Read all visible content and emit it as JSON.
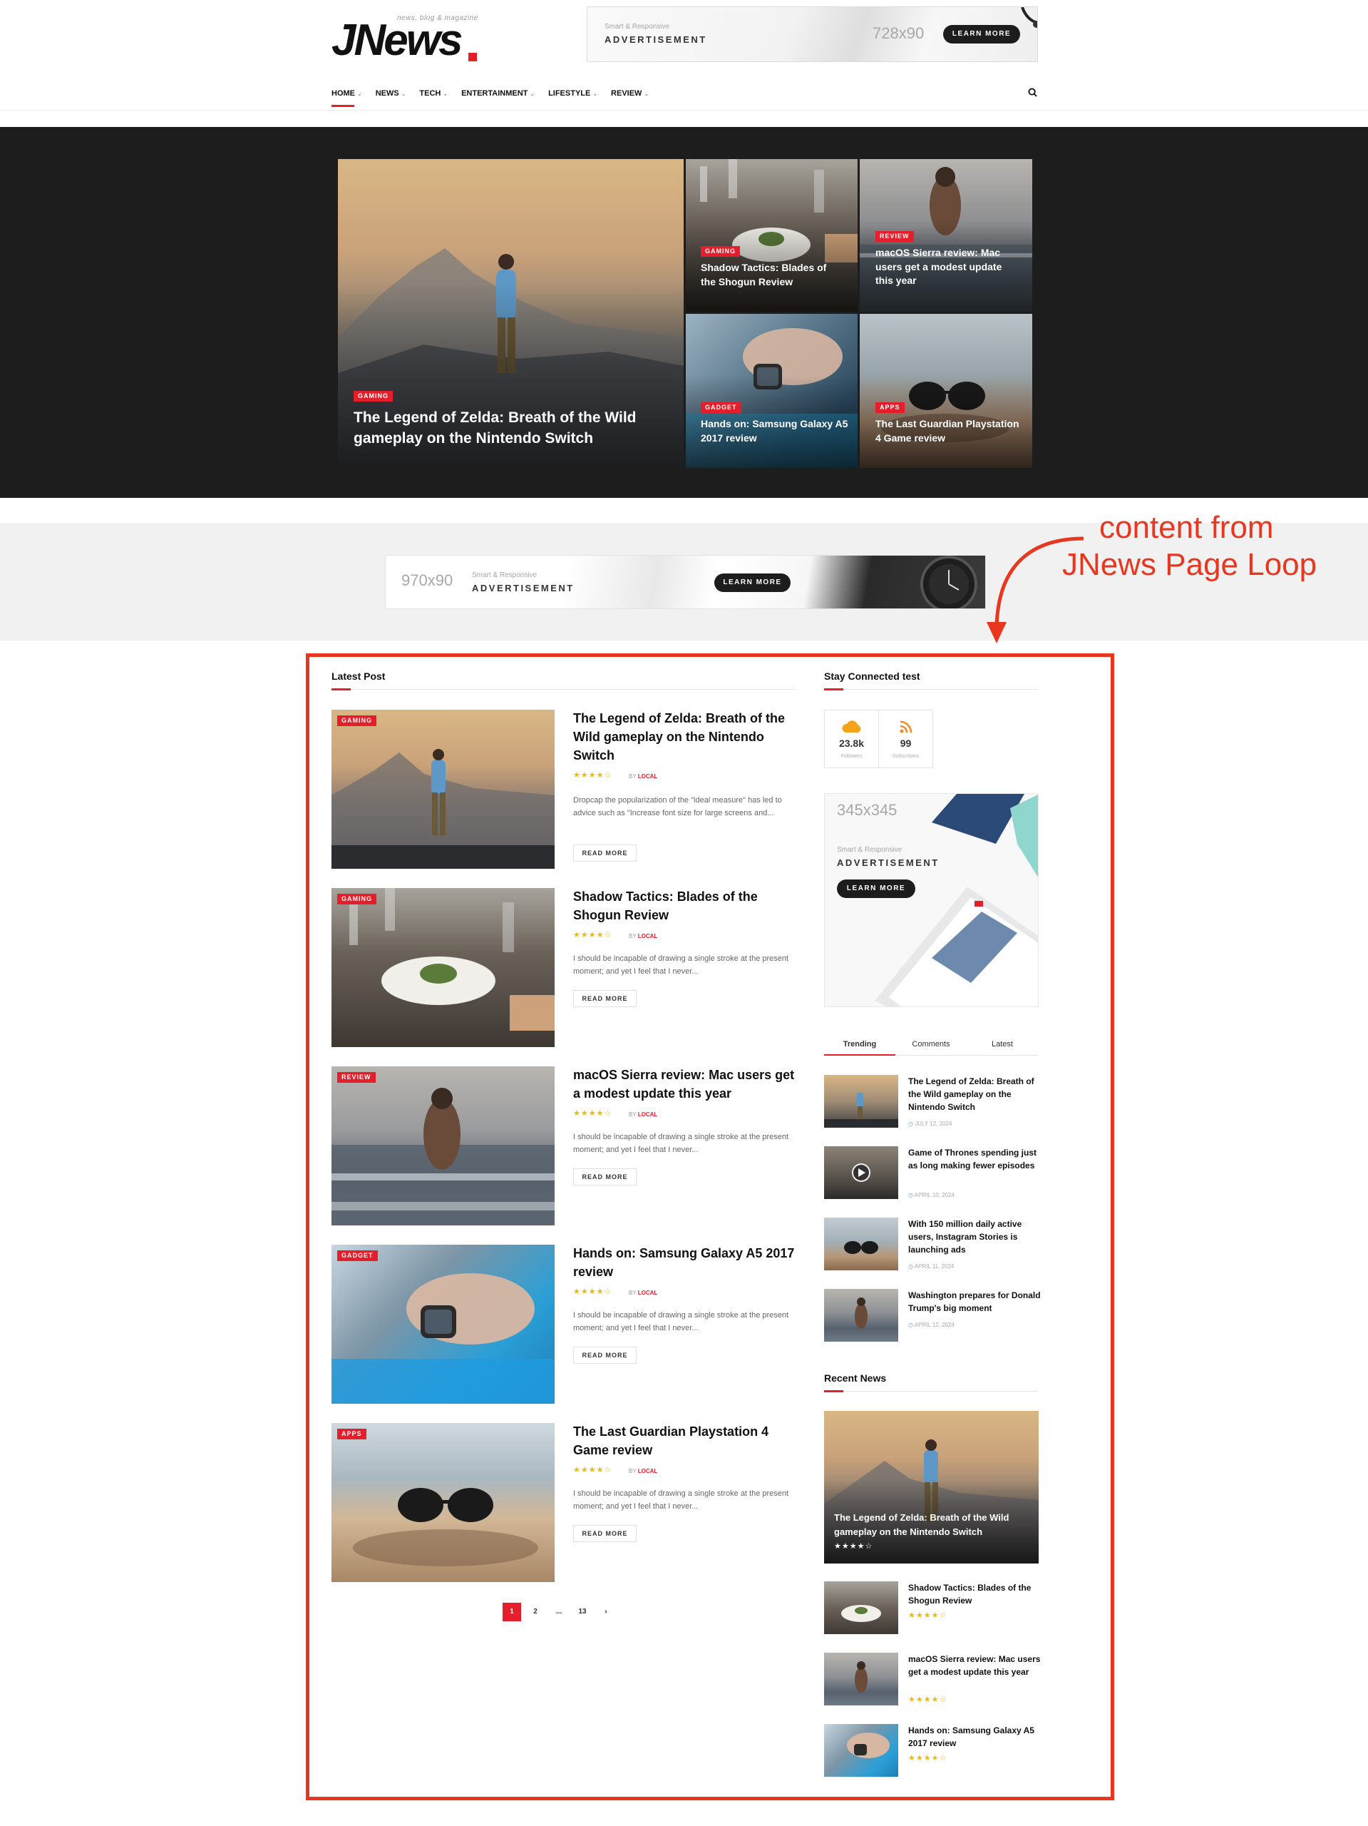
{
  "header": {
    "logo_text": "JNews",
    "logo_tagline": "news, blog & magazine",
    "ad": {
      "small": "Smart & Responsive",
      "big": "ADVERTISEMENT",
      "size": "728x90",
      "button": "LEARN MORE"
    },
    "nav": [
      {
        "label": "HOME"
      },
      {
        "label": "NEWS"
      },
      {
        "label": "TECH"
      },
      {
        "label": "ENTERTAINMENT"
      },
      {
        "label": "LIFESTYLE"
      },
      {
        "label": "REVIEW"
      }
    ]
  },
  "hero": {
    "main": {
      "category": "GAMING",
      "title": "The Legend of Zelda: Breath of the Wild gameplay on the Nintendo Switch"
    },
    "tiles": [
      {
        "category": "GAMING",
        "title": "Shadow Tactics: Blades of the Shogun Review"
      },
      {
        "category": "REVIEW",
        "title": "macOS Sierra review: Mac users get a modest update this year"
      },
      {
        "category": "GADGET",
        "title": "Hands on: Samsung Galaxy A5 2017 review"
      },
      {
        "category": "APPS",
        "title": "The Last Guardian Playstation 4 Game review"
      }
    ]
  },
  "mid_ad": {
    "size": "970x90",
    "small": "Smart & Responsive",
    "big": "ADVERTISEMENT",
    "button": "LEARN MORE"
  },
  "annotation": {
    "line1": "content from",
    "line2": "JNews Page Loop"
  },
  "latest": {
    "title": "Latest Post",
    "posts": [
      {
        "category": "GAMING",
        "title": "The Legend of Zelda: Breath of the Wild gameplay on the Nintendo Switch",
        "stars": "★★★★☆",
        "by": "BY",
        "author": "LOCAL",
        "excerpt": "Dropcap the popularization of the \"ideal measure\" has led to advice such as \"Increase font size for large screens and...",
        "read_more": "READ MORE"
      },
      {
        "category": "GAMING",
        "title": "Shadow Tactics: Blades of the Shogun Review",
        "stars": "★★★★☆",
        "by": "BY",
        "author": "LOCAL",
        "excerpt": "I should be incapable of drawing a single stroke at the present moment; and yet I feel that I never...",
        "read_more": "READ MORE"
      },
      {
        "category": "REVIEW",
        "title": "macOS Sierra review: Mac users get a modest update this year",
        "stars": "★★★★☆",
        "by": "BY",
        "author": "LOCAL",
        "excerpt": "I should be incapable of drawing a single stroke at the present moment; and yet I feel that I never...",
        "read_more": "READ MORE"
      },
      {
        "category": "GADGET",
        "title": "Hands on: Samsung Galaxy A5 2017 review",
        "stars": "★★★★☆",
        "by": "BY",
        "author": "LOCAL",
        "excerpt": "I should be incapable of drawing a single stroke at the present moment; and yet I feel that I never...",
        "read_more": "READ MORE"
      },
      {
        "category": "APPS",
        "title": "The Last Guardian Playstation 4 Game review",
        "stars": "★★★★☆",
        "by": "BY",
        "author": "LOCAL",
        "excerpt": "I should be incapable of drawing a single stroke at the present moment; and yet I feel that I never...",
        "read_more": "READ MORE"
      }
    ],
    "pagination": [
      "1",
      "2",
      "...",
      "13",
      "›"
    ]
  },
  "sidebar": {
    "connected_title": "Stay Connected test",
    "social": [
      {
        "count": "23.8k",
        "label": "Followers",
        "icon": "cloud-icon"
      },
      {
        "count": "99",
        "label": "Subscribers",
        "icon": "rss-icon"
      }
    ],
    "ad": {
      "size": "345x345",
      "small": "Smart & Responsive",
      "big": "ADVERTISEMENT",
      "button": "LEARN MORE"
    },
    "tabs": [
      "Trending",
      "Comments",
      "Latest"
    ],
    "trending": [
      {
        "title": "The Legend of Zelda: Breath of the Wild gameplay on the Nintendo Switch",
        "date": "JULY 12, 2024"
      },
      {
        "title": "Game of Thrones spending just as long making fewer episodes",
        "date": "APRIL 10, 2024"
      },
      {
        "title": "With 150 million daily active users, Instagram Stories is launching ads",
        "date": "APRIL 11, 2024"
      },
      {
        "title": "Washington prepares for Donald Trump's big moment",
        "date": "APRIL 12, 2024"
      }
    ],
    "recent_title": "Recent News",
    "recent_big": {
      "title": "The Legend of Zelda: Breath of the Wild gameplay on the Nintendo Switch",
      "stars": "★★★★☆"
    },
    "recent": [
      {
        "title": "Shadow Tactics: Blades of the Shogun Review",
        "stars": "★★★★☆"
      },
      {
        "title": "macOS Sierra review: Mac users get a modest update this year",
        "stars": "★★★★☆"
      },
      {
        "title": "Hands on: Samsung Galaxy A5 2017 review",
        "stars": "★★★★☆"
      }
    ]
  },
  "colors": {
    "accent": "#e41e2a",
    "annotation": "#e8361f",
    "hero_bg": "#1d1d1d",
    "star": "#f2b705"
  }
}
